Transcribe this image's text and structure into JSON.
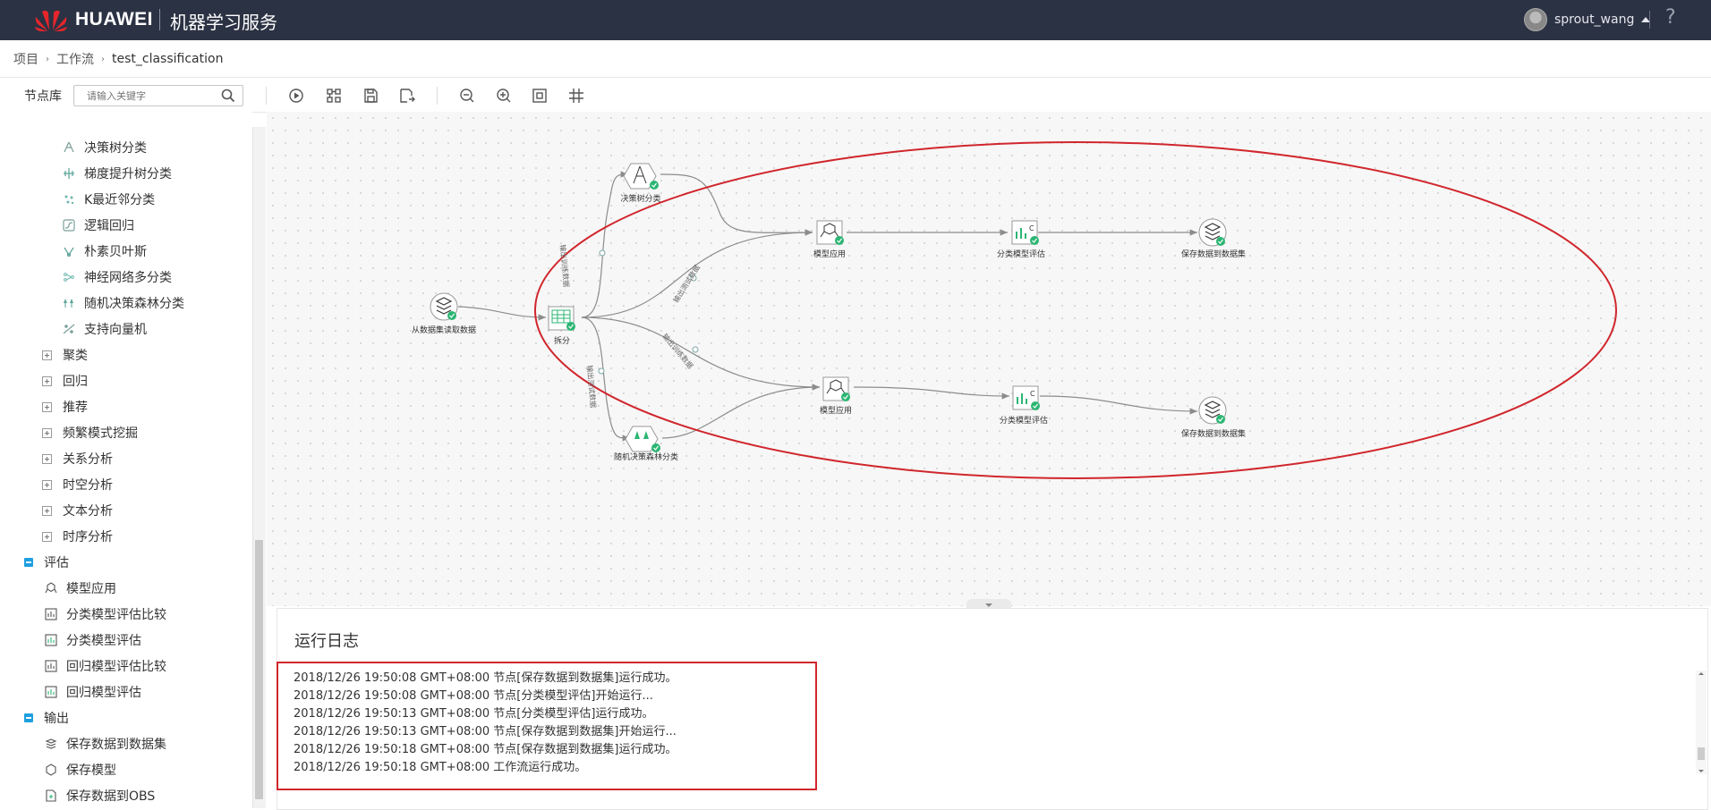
{
  "header": {
    "brand": "HUAWEI",
    "service": "机器学习服务",
    "username": "sprout_wang",
    "help": "?"
  },
  "breadcrumb": {
    "items": [
      "项目",
      "工作流"
    ],
    "current": "test_classification"
  },
  "toolbar": {
    "library_label": "节点库",
    "search_placeholder": "请输入关键字"
  },
  "sidebar": {
    "partial_top": "· · ·",
    "classification_items": [
      {
        "label": "决策树分类",
        "icon": "decision-tree-icon"
      },
      {
        "label": "梯度提升树分类",
        "icon": "gradient-boost-icon"
      },
      {
        "label": "K最近邻分类",
        "icon": "knn-icon"
      },
      {
        "label": "逻辑回归",
        "icon": "logistic-icon"
      },
      {
        "label": "朴素贝叶斯",
        "icon": "bayes-icon"
      },
      {
        "label": "神经网络多分类",
        "icon": "neural-net-icon"
      },
      {
        "label": "随机决策森林分类",
        "icon": "random-forest-icon"
      },
      {
        "label": "支持向量机",
        "icon": "svm-icon"
      }
    ],
    "collapsed_groups": [
      "聚类",
      "回归",
      "推荐",
      "频繁模式挖掘",
      "关系分析",
      "时空分析",
      "文本分析",
      "时序分析"
    ],
    "eval_group": "评估",
    "eval_items": [
      "模型应用",
      "分类模型评估比较",
      "分类模型评估",
      "回归模型评估比较",
      "回归模型评估"
    ],
    "output_group": "输出",
    "output_items": [
      "保存数据到数据集",
      "保存模型",
      "保存数据到OBS"
    ]
  },
  "canvas": {
    "nodes": {
      "read": "从数据集读取数据",
      "split": "拆分",
      "dtree": "决策树分类",
      "rforest": "随机决策森林分类",
      "apply1": "模型应用",
      "apply2": "模型应用",
      "eval1": "分类模型评估",
      "eval2": "分类模型评估",
      "save1": "保存数据到数据集",
      "save2": "保存数据到数据集"
    },
    "edge_labels": {
      "e1": "输出训练数据",
      "e2": "输出测试数据",
      "e3": "输出训练数据",
      "e4": "输出测试数据"
    },
    "colors": {
      "accent_green": "#2bb673",
      "highlight_red": "#d0262c",
      "link_gray": "#8c8c8c"
    }
  },
  "log": {
    "title": "运行日志",
    "lines": [
      "2018/12/26 19:50:08 GMT+08:00 节点[保存数据到数据集]运行成功。",
      "2018/12/26 19:50:08 GMT+08:00 节点[分类模型评估]开始运行...",
      "2018/12/26 19:50:13 GMT+08:00 节点[分类模型评估]运行成功。",
      "2018/12/26 19:50:13 GMT+08:00 节点[保存数据到数据集]开始运行...",
      "2018/12/26 19:50:18 GMT+08:00 节点[保存数据到数据集]运行成功。",
      "2018/12/26 19:50:18 GMT+08:00 工作流运行成功。"
    ]
  }
}
